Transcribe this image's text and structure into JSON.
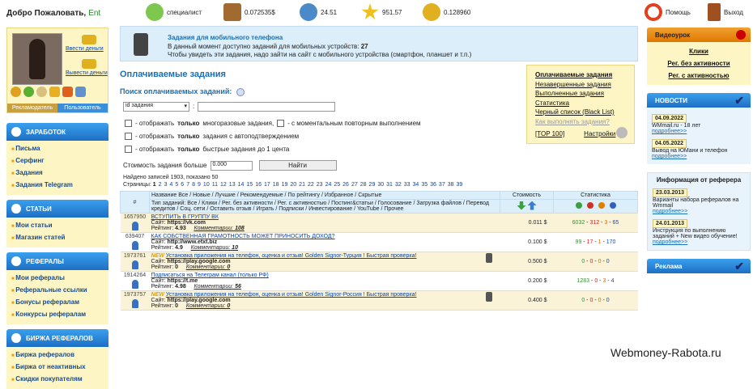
{
  "header": {
    "welcome": "Добро Пожаловать,",
    "user": "Ent",
    "specialist": "специалист",
    "balance1": "0.072535$",
    "rating": "24.51",
    "stars": "951.57",
    "coins": "0.128960",
    "help": "Помощь",
    "exit": "Выход"
  },
  "profile": {
    "deposit": "Ввести деньги",
    "withdraw": "Вывести деньги",
    "role_advertiser": "Рекламодатель",
    "role_user": "Пользователь"
  },
  "menus": [
    {
      "title": "ЗАРАБОТОК",
      "items": [
        "Письма",
        "Серфинг",
        "Задания",
        "Задания Telegram"
      ]
    },
    {
      "title": "СТАТЬИ",
      "items": [
        "Мои статьи",
        "Магазин статей"
      ]
    },
    {
      "title": "РЕФЕРАЛЫ",
      "items": [
        "Мои рефералы",
        "Реферальные ссылки",
        "Бонусы рефералам",
        "Конкурсы рефералам"
      ]
    },
    {
      "title": "БИРЖА РЕФЕРАЛОВ",
      "items": [
        "Биржа рефералов",
        "Биржа от неактивных",
        "Скидки покупателям"
      ]
    }
  ],
  "mobile": {
    "title": "Задания для мобильного телефона",
    "line1_prefix": "В данный момент доступно заданий для мобильных устройств:",
    "count": "27",
    "line2": "Чтобы увидеть эти задания, надо зайти на сайт с мобильного устройства (смартфон, планшет и т.п.)"
  },
  "page_title": "Оплачиваемые задания",
  "search": {
    "title": "Поиск оплачиваемых заданий:",
    "select": "id задания",
    "opt1": "- отображать",
    "opt1_bold": "только",
    "opt1_rest": "многоразовые задания,",
    "opt1b": "- с моментальным повторным выполнением",
    "opt2": "- отображать",
    "opt2_bold": "только",
    "opt2_rest": "задания с автоподтверждением",
    "opt3": "- отображать",
    "opt3_bold": "только",
    "opt3_rest": "быстрые задания до 1 цента",
    "price_label": "Стоимость задания больше",
    "price_value": "0.000",
    "find": "Найти"
  },
  "found": "Найдено записей 1903, показано 50",
  "pages_label": "Страницы:",
  "pages": [
    "1",
    "2",
    "3",
    "4",
    "5",
    "6",
    "7",
    "8",
    "9",
    "10",
    "11",
    "12",
    "13",
    "14",
    "15",
    "16",
    "17",
    "18",
    "19",
    "20",
    "21",
    "22",
    "23",
    "24",
    "25",
    "26",
    "27",
    "28",
    "29",
    "30",
    "31",
    "32",
    "33",
    "34",
    "35",
    "36",
    "37",
    "38",
    "39"
  ],
  "filters": [
    "Оплачиваемые задания",
    "Незавершенные задания",
    "Выполненные задания",
    "Статистика",
    "Черный список (Black List)",
    "Как выполнять задания?"
  ],
  "top100": "[TOP 100]",
  "settings": "Настройки",
  "table": {
    "hdr_hash": "#",
    "name_line": "Название Все / Новые / Лучшие / Рекомендуемые / По рейтингу / Избранное / Скрытые",
    "type_line": "Тип заданий: Все / Клики / Рег. без активности / Рег. с активностью / Постинг&статьи / Голосование / Загрузка файлов / Перевод кредитов / Соц. сети / Оставить отзыв / Играть / Подписки / Инвестирование / YouTube / Прочее",
    "hdr_cost": "Стоимость",
    "hdr_stat": "Статистика",
    "rows": [
      {
        "id": "1657950",
        "title": "ВСТУПИТЬ В ГРУППУ ВК",
        "site": "https://vk.com",
        "rating": "4.93",
        "comments": "108",
        "cost": "0.011 $",
        "s1": "6032",
        "s2": "312",
        "s3": "3",
        "s4": "65",
        "isnew": "",
        "mobile": false
      },
      {
        "id": "639407",
        "title": "КАК СОБСТВЕННАЯ ГРАМОТНОСТЬ МОЖЕТ ПРИНОСИТЬ ДОХОД?",
        "site": "http://www.etxt.biz",
        "rating": "4.9",
        "comments": "10",
        "cost": "0.100 $",
        "s1": "99",
        "s2": "17",
        "s3": "1",
        "s4": "170",
        "isnew": "",
        "mobile": false
      },
      {
        "id": "1973761",
        "title": "Установка приложения на телефон, оценка и отзыв! Golden Signor-Турция ! Быстрая проверка!",
        "site": "https://play.google.com",
        "rating": "0",
        "comments": "0",
        "cost": "0.500 $",
        "s1": "0",
        "s2": "0",
        "s3": "0",
        "s4": "0",
        "isnew": "NEW",
        "mobile": true
      },
      {
        "id": "1914264",
        "title": "Подписаться на Телеграм канал (только РФ)",
        "site": "https://t.me",
        "rating": "4.98",
        "comments": "56",
        "cost": "0.200 $",
        "s1": "1283",
        "s2": "0",
        "s3": "3",
        "s4": "4",
        "isnew": "",
        "mobile": false
      },
      {
        "id": "1973757",
        "title": "Установка приложения на телефон, оценка и отзыв! Golden Signor-Россия ! Быстрая проверка!",
        "site": "https://play.google.com",
        "rating": "0",
        "comments": "0",
        "cost": "0.400 $",
        "s1": "0",
        "s2": "0",
        "s3": "0",
        "s4": "0",
        "isnew": "NEW",
        "mobile": true
      }
    ],
    "site_label": "Сайт:",
    "rating_label": "Рейтинг:",
    "comments_label": "Комментарии:"
  },
  "right": {
    "video_title": "Видеоурок",
    "video_links": [
      "Клики",
      "Рег. без активности",
      "Рег. с активностью"
    ],
    "news_title": "НОВОСТИ",
    "news": [
      {
        "date": "04.09.2022",
        "text": "WMmail.ru - 18 лет",
        "more": "подробнее>>"
      },
      {
        "date": "04.05.2022",
        "text": "Вывод на ЮМани и телефон",
        "more": "подробнее>>"
      }
    ],
    "ref_title": "Информация от реферера",
    "ref": [
      {
        "date": "23.03.2013",
        "text": "Варианты набора рефералов на Wmmail",
        "more": "подробнее>>"
      },
      {
        "date": "24.01.2013",
        "text": "Инструкция по выполнению заданий + New видео обучение!",
        "more": "подробнее>>"
      }
    ],
    "ads_title": "Реклама"
  },
  "watermark": "Webmoney-Rabota.ru"
}
